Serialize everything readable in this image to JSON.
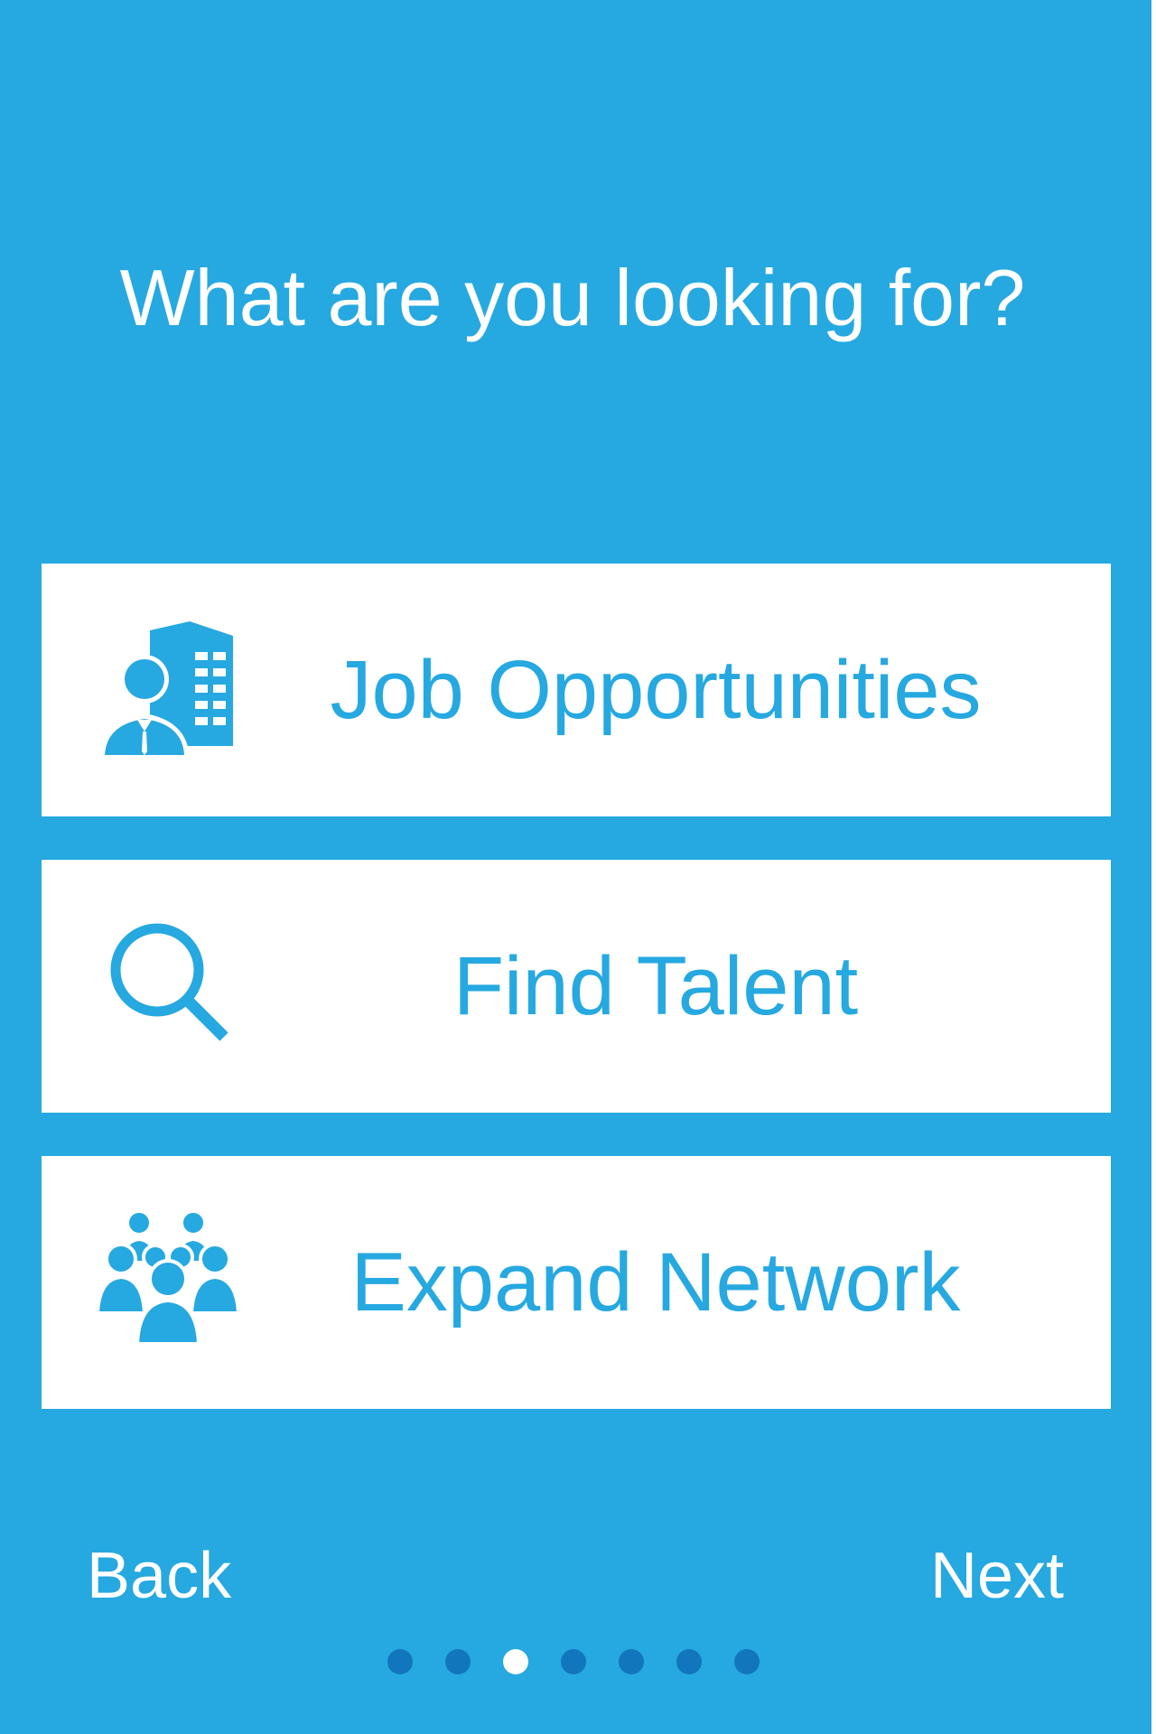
{
  "title": "What are you looking for?",
  "options": [
    {
      "label": "Job Opportunities",
      "icon": "building-person-icon"
    },
    {
      "label": "Find Talent",
      "icon": "search-icon"
    },
    {
      "label": "Expand Network",
      "icon": "people-group-icon"
    }
  ],
  "nav": {
    "back_label": "Back",
    "next_label": "Next"
  },
  "pagination": {
    "total": 7,
    "current": 3
  },
  "colors": {
    "background": "#26a8e0",
    "card": "#ffffff",
    "accent": "#26a8e0",
    "dot_inactive": "#1276bd",
    "dot_active": "#ffffff"
  }
}
